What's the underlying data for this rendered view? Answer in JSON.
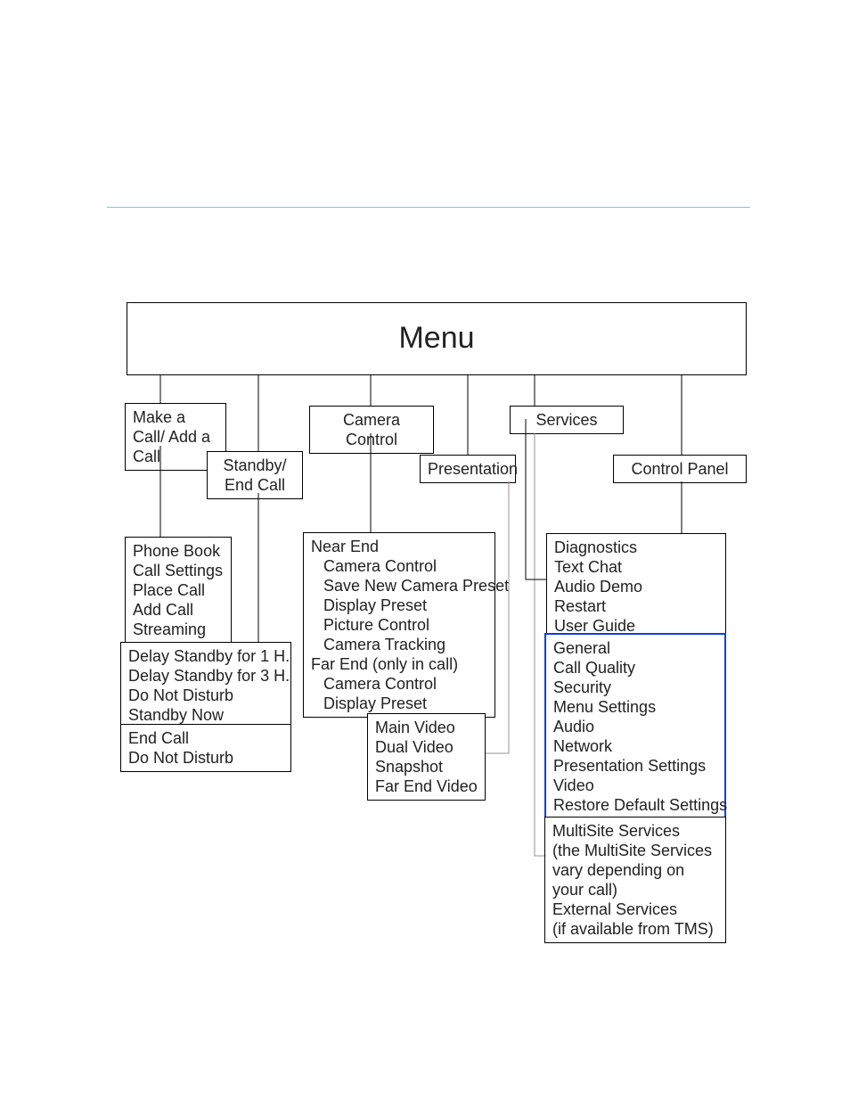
{
  "root": {
    "title": "Menu"
  },
  "level1": {
    "makeCall": "Make a Call/\nAdd a Call",
    "standby": "Standby/\nEnd Call",
    "cameraControl": "Camera Control",
    "presentation": "Presentation",
    "services": "Services",
    "controlPanel": "Control Panel"
  },
  "makeCall_children": {
    "lines": [
      "Phone Book",
      "Call Settings",
      "Place Call",
      "Add Call",
      "Streaming"
    ]
  },
  "standby_children_a": {
    "lines": [
      "Delay Standby for 1 H.",
      "Delay Standby for 3 H.",
      "Do Not Disturb",
      "Standby Now"
    ]
  },
  "standby_children_b": {
    "lines": [
      "End Call",
      "Do Not Disturb"
    ]
  },
  "cameraControl_children": {
    "groups": [
      {
        "header": "Near End",
        "items": [
          "Camera Control",
          "Save New Camera Preset",
          "Display Preset",
          "Picture Control",
          "Camera Tracking"
        ]
      },
      {
        "header": "Far End (only in call)",
        "items": [
          "Camera Control",
          "Display Preset"
        ]
      }
    ]
  },
  "presentation_children": {
    "lines": [
      "Main Video",
      "Dual Video",
      "Snapshot",
      "Far End Video"
    ]
  },
  "controlPanel_children_a": {
    "lines": [
      "Diagnostics",
      "Text Chat",
      "Audio Demo",
      "Restart",
      "User Guide"
    ]
  },
  "controlPanel_children_b": {
    "lines": [
      "General",
      "Call Quality",
      "Security",
      "Menu Settings",
      "Audio",
      "Network",
      "Presentation Settings",
      "Video",
      "Restore Default Settings"
    ]
  },
  "services_children": {
    "lines": [
      "MultiSite Services",
      "(the MultiSite Services",
      "vary depending on",
      "your call)",
      "External Services",
      "(if available from TMS)"
    ]
  }
}
